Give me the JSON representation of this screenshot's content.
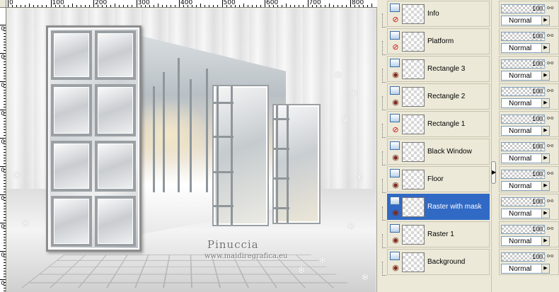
{
  "ruler": {
    "h_labels": [
      "0",
      "100",
      "200",
      "300",
      "400",
      "500",
      "600",
      "700",
      "800"
    ],
    "v_labels": [
      "0",
      "0",
      "0",
      "0",
      "0",
      "0",
      "0",
      "0",
      "0",
      "0"
    ]
  },
  "canvas": {
    "watermark_title": "Pinuccia",
    "watermark_url": "www.maidiregrafica.eu"
  },
  "layers": [
    {
      "name": "Info",
      "visible": false,
      "selected": false,
      "opacity": "100",
      "blend": "Normal"
    },
    {
      "name": "Platform",
      "visible": false,
      "selected": false,
      "opacity": "100",
      "blend": "Normal"
    },
    {
      "name": "Rectangle 3",
      "visible": true,
      "selected": false,
      "opacity": "100",
      "blend": "Normal"
    },
    {
      "name": "Rectangle 2",
      "visible": true,
      "selected": false,
      "opacity": "100",
      "blend": "Normal"
    },
    {
      "name": "Rectangle 1",
      "visible": false,
      "selected": false,
      "opacity": "100",
      "blend": "Normal"
    },
    {
      "name": "Black Window",
      "visible": true,
      "selected": false,
      "opacity": "100",
      "blend": "Normal"
    },
    {
      "name": "Floor",
      "visible": true,
      "selected": false,
      "opacity": "100",
      "blend": "Normal"
    },
    {
      "name": "Raster with mask",
      "visible": true,
      "selected": true,
      "opacity": "100",
      "blend": "Normal"
    },
    {
      "name": "Raster 1",
      "visible": true,
      "selected": false,
      "opacity": "100",
      "blend": "Normal"
    },
    {
      "name": "Background",
      "visible": true,
      "selected": false,
      "opacity": "100",
      "blend": "Normal"
    }
  ],
  "icons": {
    "layer_type": "raster-layer-icon",
    "visible": "eye-icon",
    "hidden": "visibility-off-icon",
    "link": "link-icon",
    "dropdown": "dropdown-arrow-icon",
    "splitter": "collapse-arrow-icon"
  },
  "colors": {
    "selection": "#316ac5",
    "panel_bg": "#ece9d8"
  }
}
